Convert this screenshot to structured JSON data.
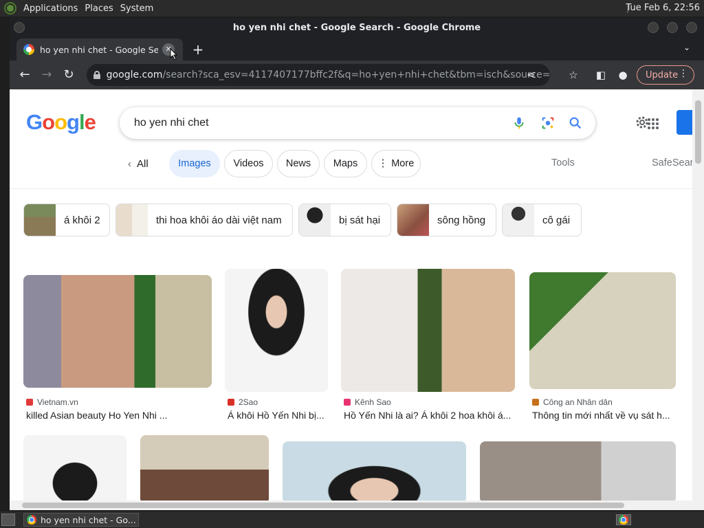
{
  "system_panel": {
    "menus": [
      "Applications",
      "Places",
      "System"
    ],
    "clock": "Tue Feb  6, 22:56"
  },
  "window": {
    "title": "ho yen nhi chet - Google Search - Google Chrome",
    "tab_title": "ho yen nhi chet - Google Search",
    "url_host": "google.com",
    "url_path": "/search?sca_esv=4117407177bffc2f&q=ho+yen+nhi+chet&tbm=isch&source=lnms&sa=...",
    "update_label": "Update"
  },
  "search": {
    "query": "ho yen nhi chet"
  },
  "filters": {
    "all": "All",
    "pills": [
      "Images",
      "Videos",
      "News",
      "Maps",
      "More"
    ],
    "active": "Images",
    "tools": "Tools",
    "safesearch": "SafeSear"
  },
  "chips": [
    "á khôi 2",
    "thi hoa khôi áo dài việt nam",
    "bị sát hại",
    "sông hồng",
    "cô gái"
  ],
  "results_row1": [
    {
      "source": "Vietnam.vn",
      "title": "killed Asian beauty Ho Yen Nhi ...",
      "source_color": "#e03a3a"
    },
    {
      "source": "2Sao",
      "title": "Á khôi Hồ Yến Nhi bị...",
      "source_color": "#d93025"
    },
    {
      "source": "Kênh Sao",
      "title": "Hồ Yến Nhi là ai? Á khôi 2 hoa khôi á...",
      "source_color": "#e8336f"
    },
    {
      "source": "Công an Nhân dân",
      "title": "Thông tin mới nhất về vụ sát h...",
      "source_color": "#c5701a"
    }
  ],
  "taskbar": {
    "item": "ho yen nhi chet - Go..."
  }
}
